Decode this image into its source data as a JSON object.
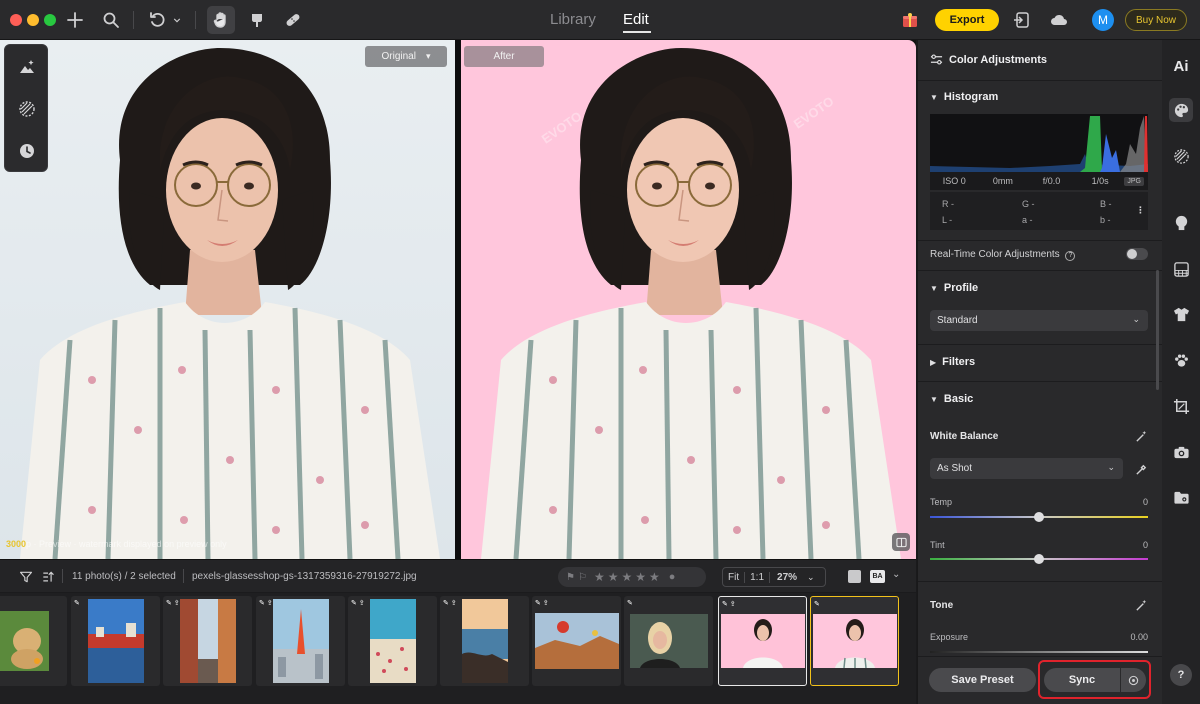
{
  "titlebar": {
    "tabs": [
      {
        "label": "Library",
        "active": false
      },
      {
        "label": "Edit",
        "active": true
      }
    ],
    "export_label": "Export",
    "avatar_initial": "M",
    "buy_now_label": "Buy Now"
  },
  "canvas": {
    "original_label": "Original",
    "after_label": "After",
    "watermark": "EVOTO",
    "preview_note_highlight": "3000",
    "preview_note_text": "p · Preview · watermark displayed on preview only"
  },
  "filmstrip_bar": {
    "selection_count": "11 photo(s) / 2 selected",
    "filename": "pexels-glassesshop-gs-1317359316-27919272.jpg",
    "fit_label": "Fit",
    "one_to_one_label": "1:1",
    "zoom_value": "27%",
    "rating_stars": 5
  },
  "thumbnails": [
    {
      "name": "dog"
    },
    {
      "name": "city-bridge"
    },
    {
      "name": "street"
    },
    {
      "name": "tower-city"
    },
    {
      "name": "beach"
    },
    {
      "name": "cliff"
    },
    {
      "name": "balloons"
    },
    {
      "name": "woman-blonde"
    },
    {
      "name": "woman-pink-1",
      "selection": "white"
    },
    {
      "name": "woman-pink-2",
      "selection": "yellow"
    }
  ],
  "panel": {
    "title": "Color Adjustments",
    "histogram_title": "Histogram",
    "meta": {
      "iso": "ISO 0",
      "focal": "0mm",
      "aperture": "f/0.0",
      "shutter": "1/0s",
      "format": "JPG"
    },
    "readout": {
      "r": "R -",
      "g": "G -",
      "b": "B -",
      "l": "L -",
      "a": "a -",
      "b2": "b -"
    },
    "realtime_label": "Real-Time Color Adjustments",
    "profile_title": "Profile",
    "profile_value": "Standard",
    "filters_title": "Filters",
    "basic_title": "Basic",
    "white_balance_label": "White Balance",
    "white_balance_value": "As Shot",
    "temp_label": "Temp",
    "temp_value": "0",
    "tint_label": "Tint",
    "tint_value": "0",
    "tone_title": "Tone",
    "exposure_label": "Exposure",
    "exposure_value": "0.00",
    "save_preset_label": "Save Preset",
    "sync_label": "Sync"
  },
  "rail": {
    "ai_label": "Ai",
    "help_label": "?"
  },
  "colors": {
    "accent_yellow": "#ffd200",
    "highlight_red": "#e0232c",
    "after_background": "#ffc6dc"
  }
}
